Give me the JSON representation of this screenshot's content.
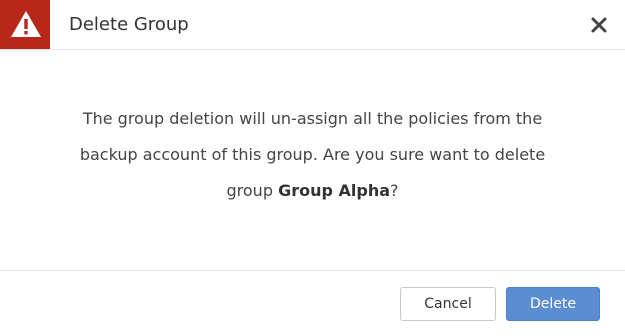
{
  "dialog": {
    "title": "Delete Group",
    "message_part1": "The group deletion will un-assign all the policies from the backup account of this group. Are you sure want to delete group ",
    "group_name": "Group Alpha",
    "message_part2": "?",
    "cancel_label": "Cancel",
    "delete_label": "Delete"
  },
  "icons": {
    "header_icon": "warning-icon",
    "close_icon": "close-icon"
  },
  "colors": {
    "warning_bg": "#b7281b",
    "primary_button": "#5a8dd1"
  }
}
